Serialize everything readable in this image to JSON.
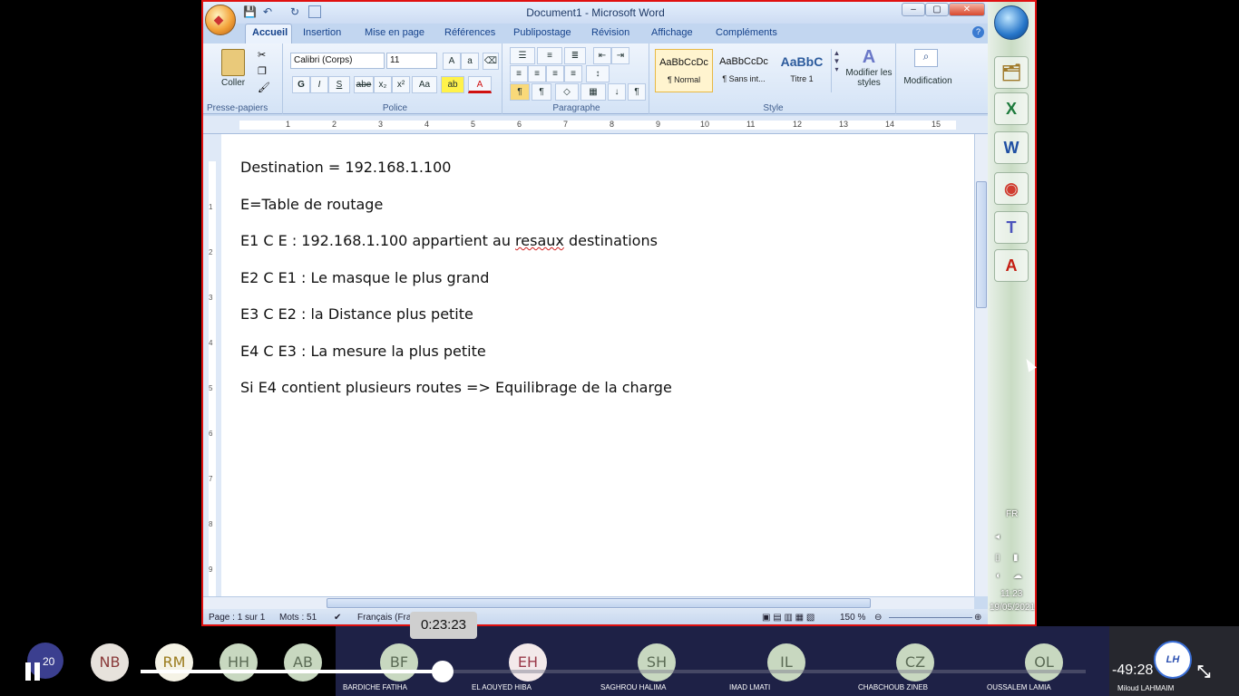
{
  "window": {
    "title": "Document1 - Microsoft Word",
    "controls": {
      "minimize": "–",
      "maximize": "▢",
      "close": "✕"
    }
  },
  "quick_access": {
    "save": "💾",
    "undo": "↶",
    "redo": "↻"
  },
  "tabs": [
    "Accueil",
    "Insertion",
    "Mise en page",
    "Références",
    "Publipostage",
    "Révision",
    "Affichage",
    "Compléments"
  ],
  "ribbon": {
    "clipboard": {
      "label": "Presse-papiers",
      "paste": "Coller"
    },
    "font": {
      "label": "Police",
      "font_name": "Calibri (Corps)",
      "font_size": "11",
      "bold": "G",
      "italic": "I",
      "underline": "S",
      "strike": "abe",
      "sub": "x₂",
      "sup": "x²",
      "case": "Aa"
    },
    "paragraph": {
      "label": "Paragraphe"
    },
    "style": {
      "label": "Style",
      "items": [
        {
          "preview": "AaBbCcDc",
          "name": "¶ Normal"
        },
        {
          "preview": "AaBbCcDc",
          "name": "¶ Sans int..."
        },
        {
          "preview": "AaBbC",
          "name": "Titre 1"
        }
      ],
      "modify": "Modifier les styles",
      "modification": "Modification"
    }
  },
  "ruler": {
    "numbers": [
      "1",
      "2",
      "3",
      "4",
      "5",
      "6",
      "7",
      "8",
      "9",
      "10",
      "11",
      "12",
      "13",
      "14",
      "15"
    ]
  },
  "vruler": {
    "numbers": [
      "1",
      "2",
      "3",
      "4",
      "5",
      "6",
      "7",
      "8",
      "9"
    ]
  },
  "document": {
    "lines": [
      "Destination = 192.168.1.100",
      "E=Table de routage",
      "E1 C E : 192.168.1.100 appartient au resaux destinations",
      "E2 C E1 : Le masque le plus grand",
      "E3 C E2 : la Distance plus petite",
      "E4 C E3 : La mesure la plus petite",
      "Si E4 contient plusieurs routes => Equilibrage de la charge"
    ],
    "line3_pre": "E1 C E : 192.168.1.100 appartient au ",
    "line3_err": "resaux",
    "line3_post": " destinations"
  },
  "statusbar": {
    "page": "Page : 1 sur 1",
    "words": "Mots : 51",
    "language": "Français (Fra",
    "zoom": "150 %"
  },
  "taskbar": {
    "apps": [
      {
        "name": "file-explorer-icon",
        "glyph": "🗂"
      },
      {
        "name": "excel-icon",
        "glyph": "X"
      },
      {
        "name": "word-icon",
        "glyph": "W"
      },
      {
        "name": "chrome-icon",
        "glyph": "◉"
      },
      {
        "name": "teams-icon",
        "glyph": "T"
      },
      {
        "name": "acrobat-icon",
        "glyph": "A"
      }
    ],
    "lang": "FR",
    "time": "11:23",
    "date": "19/05/2021"
  },
  "player": {
    "participant_count": "20",
    "elapsed": "0:23:23",
    "remaining": "-49:28",
    "progress": 0.32,
    "participants": [
      {
        "initials": "NB",
        "name": ""
      },
      {
        "initials": "RM",
        "name": ""
      },
      {
        "initials": "HH",
        "name": ""
      },
      {
        "initials": "AB",
        "name": ""
      },
      {
        "initials": "BF",
        "name": "BARDICHE FATIHA"
      },
      {
        "initials": "EH",
        "name": "EL AOUYED HIBA"
      },
      {
        "initials": "SH",
        "name": "SAGHROU HALIMA"
      },
      {
        "initials": "IL",
        "name": "IMAD LMATI"
      },
      {
        "initials": "CZ",
        "name": "CHABCHOUB ZINEB"
      },
      {
        "initials": "OL",
        "name": "OUSSALEM LAMIA"
      }
    ],
    "host": {
      "logo": "LH",
      "name": "Miloud LAHMAIM"
    }
  },
  "colors": {
    "window_border": "#e01010",
    "panel": "#1e2146",
    "accent": "#3b3f8f"
  }
}
